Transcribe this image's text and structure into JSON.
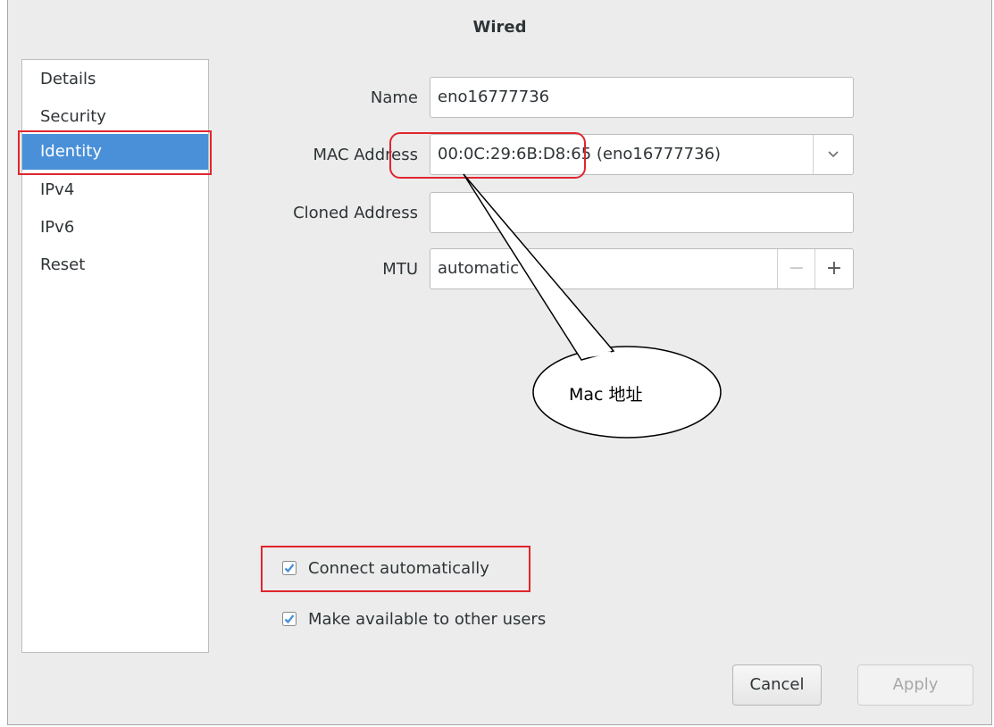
{
  "window": {
    "title": "Wired"
  },
  "sidebar": {
    "items": [
      {
        "label": "Details"
      },
      {
        "label": "Security"
      },
      {
        "label": "Identity"
      },
      {
        "label": "IPv4"
      },
      {
        "label": "IPv6"
      },
      {
        "label": "Reset"
      }
    ],
    "selected": "Identity"
  },
  "form": {
    "name_label": "Name",
    "name_value": "eno16777736",
    "mac_label": "MAC Address",
    "mac_value": "00:0C:29:6B:D8:65 (eno16777736)",
    "cloned_label": "Cloned Address",
    "cloned_value": "",
    "mtu_label": "MTU",
    "mtu_value": "automatic",
    "mtu_minus": "−",
    "mtu_plus": "+"
  },
  "checkboxes": {
    "connect_auto": {
      "label": "Connect automatically",
      "checked": true
    },
    "available_all": {
      "label": "Make available to other users",
      "checked": true
    }
  },
  "buttons": {
    "cancel": "Cancel",
    "apply": "Apply"
  },
  "annotation": {
    "callout_text": "Mac 地址",
    "highlight_color": "#e0262e"
  },
  "colors": {
    "selection": "#4a90d9",
    "check": "#4a90d9"
  }
}
